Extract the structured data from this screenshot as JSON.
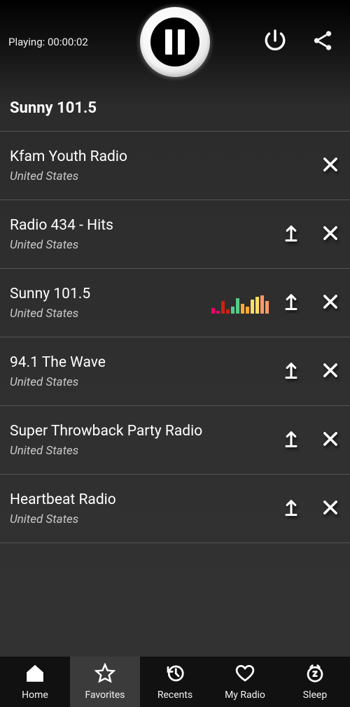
{
  "player": {
    "playing_label": "Playing: 00:00:02",
    "now_playing": "Sunny 101.5"
  },
  "stations": [
    {
      "name": "Kfam Youth Radio",
      "subtitle": "United States",
      "has_pin": false,
      "playing": false
    },
    {
      "name": "Radio 434 - Hits",
      "subtitle": "United States",
      "has_pin": true,
      "playing": false
    },
    {
      "name": "Sunny 101.5",
      "subtitle": "United States",
      "has_pin": true,
      "playing": true
    },
    {
      "name": "94.1 The Wave",
      "subtitle": "United States",
      "has_pin": true,
      "playing": false
    },
    {
      "name": "Super Throwback Party Radio",
      "subtitle": "United States",
      "has_pin": true,
      "playing": false
    },
    {
      "name": "Heartbeat Radio",
      "subtitle": "United States",
      "has_pin": true,
      "playing": false
    }
  ],
  "eq": {
    "heights": [
      8,
      4,
      18,
      6,
      10,
      22,
      14,
      10,
      20,
      24,
      26,
      18
    ],
    "colors": [
      "#e06",
      "#e06",
      "#c21",
      "#c21",
      "#5c8",
      "#5c8",
      "#fa3",
      "#fa3",
      "#fd6",
      "#fd6",
      "#f96",
      "#f96"
    ]
  },
  "nav": [
    {
      "key": "home",
      "label": "Home",
      "active": false
    },
    {
      "key": "favorites",
      "label": "Favorites",
      "active": true
    },
    {
      "key": "recents",
      "label": "Recents",
      "active": false
    },
    {
      "key": "myradio",
      "label": "My Radio",
      "active": false
    },
    {
      "key": "sleep",
      "label": "Sleep",
      "active": false
    }
  ]
}
